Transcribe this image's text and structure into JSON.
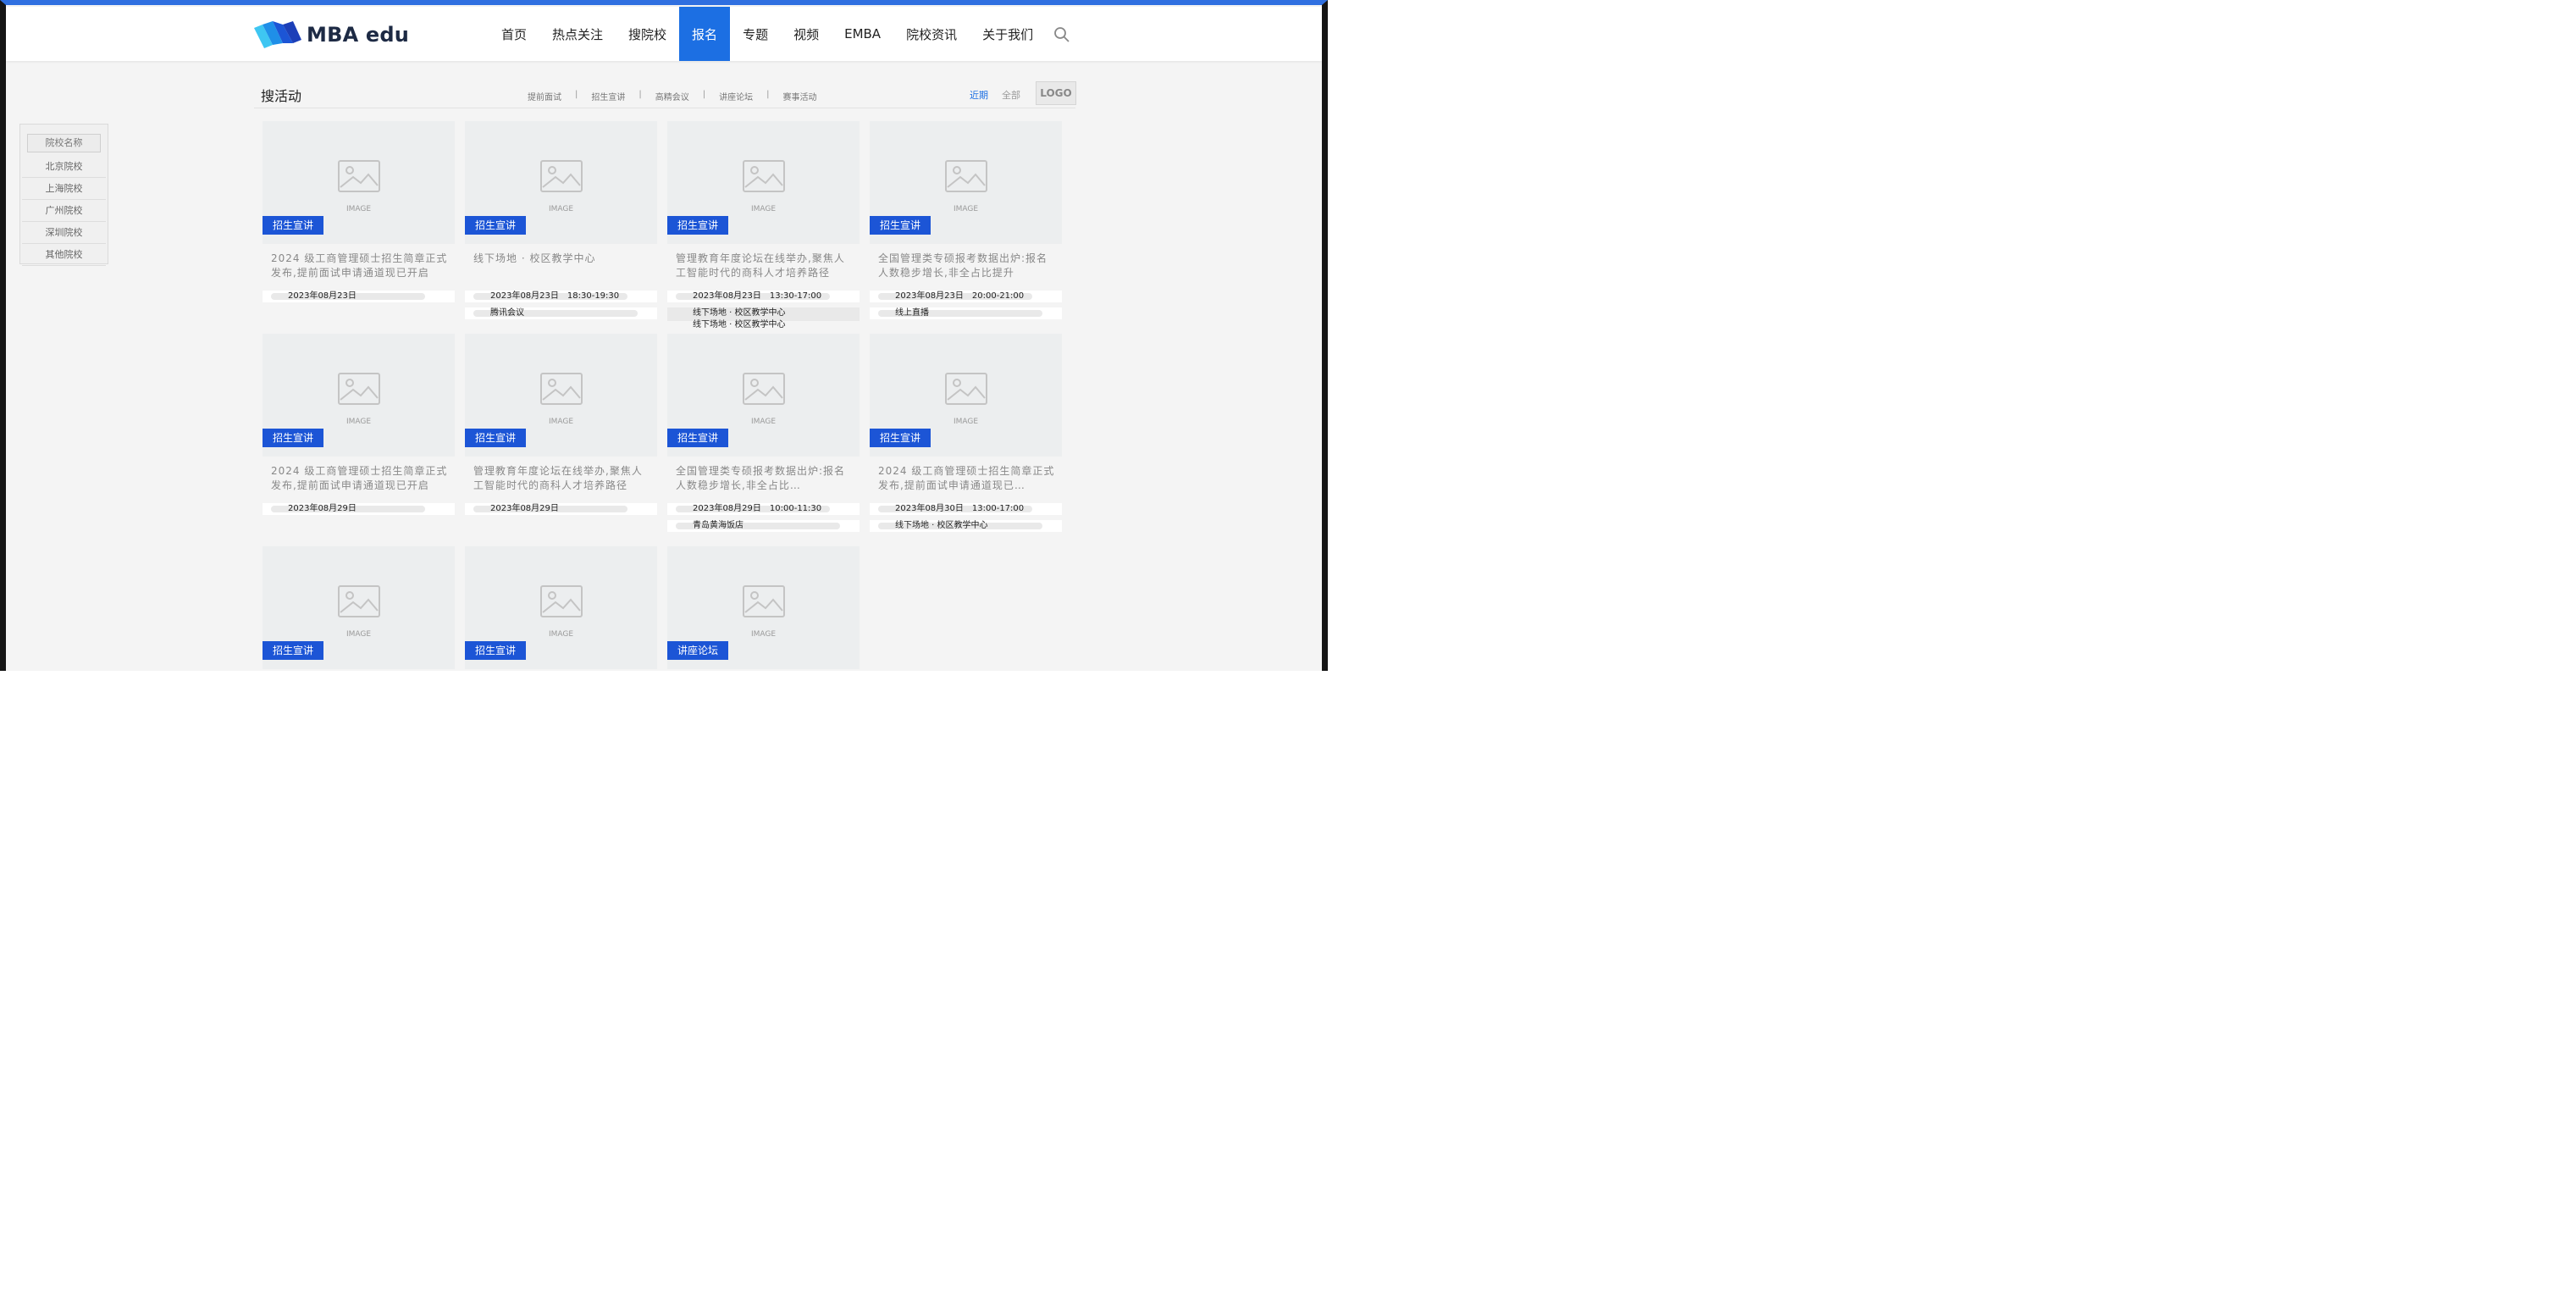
{
  "brand": {
    "name": "MBA edu"
  },
  "nav": [
    "首页",
    "热点关注",
    "搜院校",
    "报名",
    "专题",
    "视频",
    "EMBA",
    "院校资讯",
    "关于我们"
  ],
  "nav_active": 3,
  "section": {
    "title": "搜活动",
    "filters": [
      "提前面试",
      "招生宣讲",
      "高精会议",
      "讲座论坛",
      "赛事活动"
    ],
    "range": [
      "近期",
      "全部"
    ],
    "logo_label": "LOGO"
  },
  "sidebar": {
    "head": "院校名称",
    "items": [
      "北京院校",
      "上海院校",
      "广州院校",
      "深圳院校",
      "其他院校"
    ]
  },
  "image_placeholder": "IMAGE",
  "cards": [
    {
      "tag": "招生宣讲",
      "title": "2024 级工商管理硕士招生简章正式发布,提前面试申请通道现已开启",
      "line1": "2023年08月23日",
      "line2": ""
    },
    {
      "tag": "招生宣讲",
      "title": "线下场地 · 校区教学中心",
      "line1": "2023年08月23日　18:30-19:30",
      "line2": "腾讯会议"
    },
    {
      "tag": "招生宣讲",
      "title": "管理教育年度论坛在线举办,聚焦人工智能时代的商科人才培养路径",
      "line1": "2023年08月23日　13:30-17:00",
      "line2": "线下场地 · 校区教学中心",
      "line3": "线下场地 · 校区教学中心"
    },
    {
      "tag": "招生宣讲",
      "title": "全国管理类专硕报考数据出炉:报名人数稳步增长,非全占比提升",
      "line1": "2023年08月23日　20:00-21:00",
      "line2": "线上直播"
    },
    {
      "tag": "招生宣讲",
      "title": "2024 级工商管理硕士招生简章正式发布,提前面试申请通道现已开启",
      "line1": "2023年08月29日",
      "line2": ""
    },
    {
      "tag": "招生宣讲",
      "title": "管理教育年度论坛在线举办,聚焦人工智能时代的商科人才培养路径",
      "line1": "2023年08月29日",
      "line2": ""
    },
    {
      "tag": "招生宣讲",
      "title": "全国管理类专硕报考数据出炉:报名人数稳步增长,非全占比…",
      "line1": "2023年08月29日　10:00-11:30",
      "line2": "青岛黄海饭店"
    },
    {
      "tag": "招生宣讲",
      "title": "2024 级工商管理硕士招生简章正式发布,提前面试申请通道现已…",
      "line1": "2023年08月30日　13:00-17:00",
      "line2": "线下场地 · 校区教学中心"
    },
    {
      "tag": "招生宣讲",
      "title": "",
      "line1": "",
      "line2": ""
    },
    {
      "tag": "招生宣讲",
      "title": "",
      "line1": "",
      "line2": ""
    },
    {
      "tag": "讲座论坛",
      "title": "",
      "line1": "",
      "line2": ""
    }
  ]
}
